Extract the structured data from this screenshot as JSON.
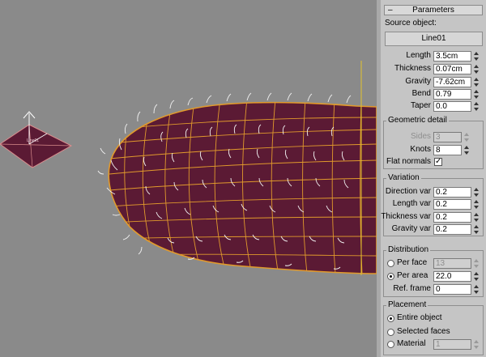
{
  "viewport": {
    "selected_object_label": "Line01"
  },
  "panel": {
    "rollout_title": "Parameters",
    "rollout_toggle": "–",
    "source_object_label": "Source object:",
    "source_object_button": "Line01",
    "params": [
      {
        "label": "Length",
        "value": "3.5cm"
      },
      {
        "label": "Thickness",
        "value": "0.07cm"
      },
      {
        "label": "Gravity",
        "value": "-7.62cm"
      },
      {
        "label": "Bend",
        "value": "0.79"
      },
      {
        "label": "Taper",
        "value": "0.0"
      }
    ],
    "geometric": {
      "title": "Geometric detail",
      "sides_label": "Sides",
      "sides_value": "3",
      "knots_label": "Knots",
      "knots_value": "8",
      "flat_normals_label": "Flat normals",
      "flat_normals_checked": "✓"
    },
    "variation": {
      "title": "Variation",
      "items": [
        {
          "label": "Direction var",
          "value": "0.2"
        },
        {
          "label": "Length var",
          "value": "0.2"
        },
        {
          "label": "Thickness var",
          "value": "0.2"
        },
        {
          "label": "Gravity var",
          "value": "0.2"
        }
      ]
    },
    "distribution": {
      "title": "Distribution",
      "per_face_label": "Per face",
      "per_face_value": "13",
      "per_area_label": "Per area",
      "per_area_value": "22.0",
      "ref_frame_label": "Ref. frame",
      "ref_frame_value": "0"
    },
    "placement": {
      "title": "Placement",
      "entire_label": "Entire object",
      "selected_label": "Selected faces",
      "material_label": "Material",
      "material_value": "1"
    }
  },
  "colors": {
    "viewport_bg": "#8a8a8a",
    "mesh_fill": "#5b1a34",
    "mesh_wire": "#e19a2c",
    "hair": "#f2f2f2",
    "panel_bg": "#c5c5c5"
  }
}
